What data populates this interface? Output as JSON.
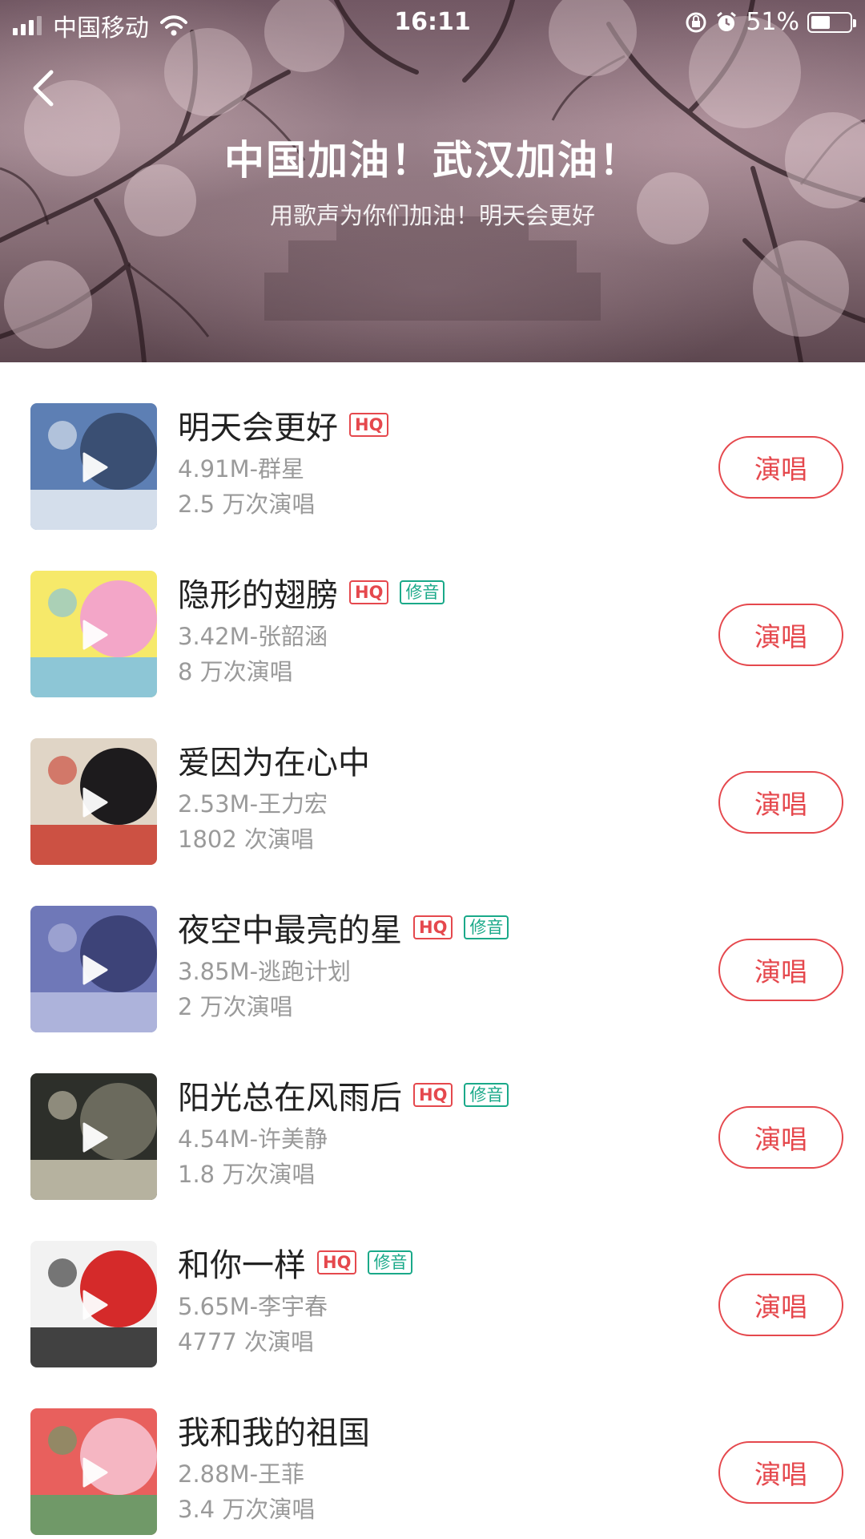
{
  "status_bar": {
    "carrier": "中国移动",
    "time": "16:11",
    "battery": "51%",
    "battery_level": 0.51,
    "icons": [
      "signal-icon",
      "wifi-icon",
      "rotation-lock-icon",
      "alarm-icon",
      "battery-icon"
    ]
  },
  "header": {
    "back_icon": "chevron-left-icon",
    "title": "中国加油！武汉加油！",
    "subtitle": "用歌声为你们加油！明天会更好"
  },
  "colors": {
    "accent": "#e5484d",
    "fix_badge": "#1aa989",
    "title_text": "#222222",
    "secondary_text": "#9a9a9a"
  },
  "songs": [
    {
      "title": "明天会更好",
      "hq": "HQ",
      "fix": null,
      "meta": "4.91M-群星",
      "plays": "2.5 万次演唱",
      "button": "演唱",
      "cover_colors": [
        "#5d7fb4",
        "#3a4f73",
        "#e9eef5"
      ]
    },
    {
      "title": "隐形的翅膀",
      "hq": "HQ",
      "fix": "修音",
      "meta": "3.42M-张韶涵",
      "plays": "8 万次演唱",
      "button": "演唱",
      "cover_colors": [
        "#f6e96a",
        "#f3a6c8",
        "#7ac0e9"
      ]
    },
    {
      "title": "爱因为在心中",
      "hq": null,
      "fix": null,
      "meta": "2.53M-王力宏",
      "plays": "1802 次演唱",
      "button": "演唱",
      "cover_colors": [
        "#e0d5c6",
        "#1d1b1d",
        "#c83a2b"
      ]
    },
    {
      "title": "夜空中最亮的星",
      "hq": "HQ",
      "fix": "修音",
      "meta": "3.85M-逃跑计划",
      "plays": "2 万次演唱",
      "button": "演唱",
      "cover_colors": [
        "#6f78b8",
        "#3d4378",
        "#b9bde0"
      ]
    },
    {
      "title": "阳光总在风雨后",
      "hq": "HQ",
      "fix": "修音",
      "meta": "4.54M-许美静",
      "plays": "1.8 万次演唱",
      "button": "演唱",
      "cover_colors": [
        "#2d2f2a",
        "#6b6a5d",
        "#cfc9b4"
      ]
    },
    {
      "title": "和你一样",
      "hq": "HQ",
      "fix": "修音",
      "meta": "5.65M-李宇春",
      "plays": "4777 次演唱",
      "button": "演唱",
      "cover_colors": [
        "#f2f2f2",
        "#d52a2a",
        "#222222"
      ]
    },
    {
      "title": "我和我的祖国",
      "hq": null,
      "fix": null,
      "meta": "2.88M-王菲",
      "plays": "3.4 万次演唱",
      "button": "演唱",
      "cover_colors": [
        "#e8605d",
        "#f5b6c2",
        "#5aa36a"
      ]
    }
  ]
}
